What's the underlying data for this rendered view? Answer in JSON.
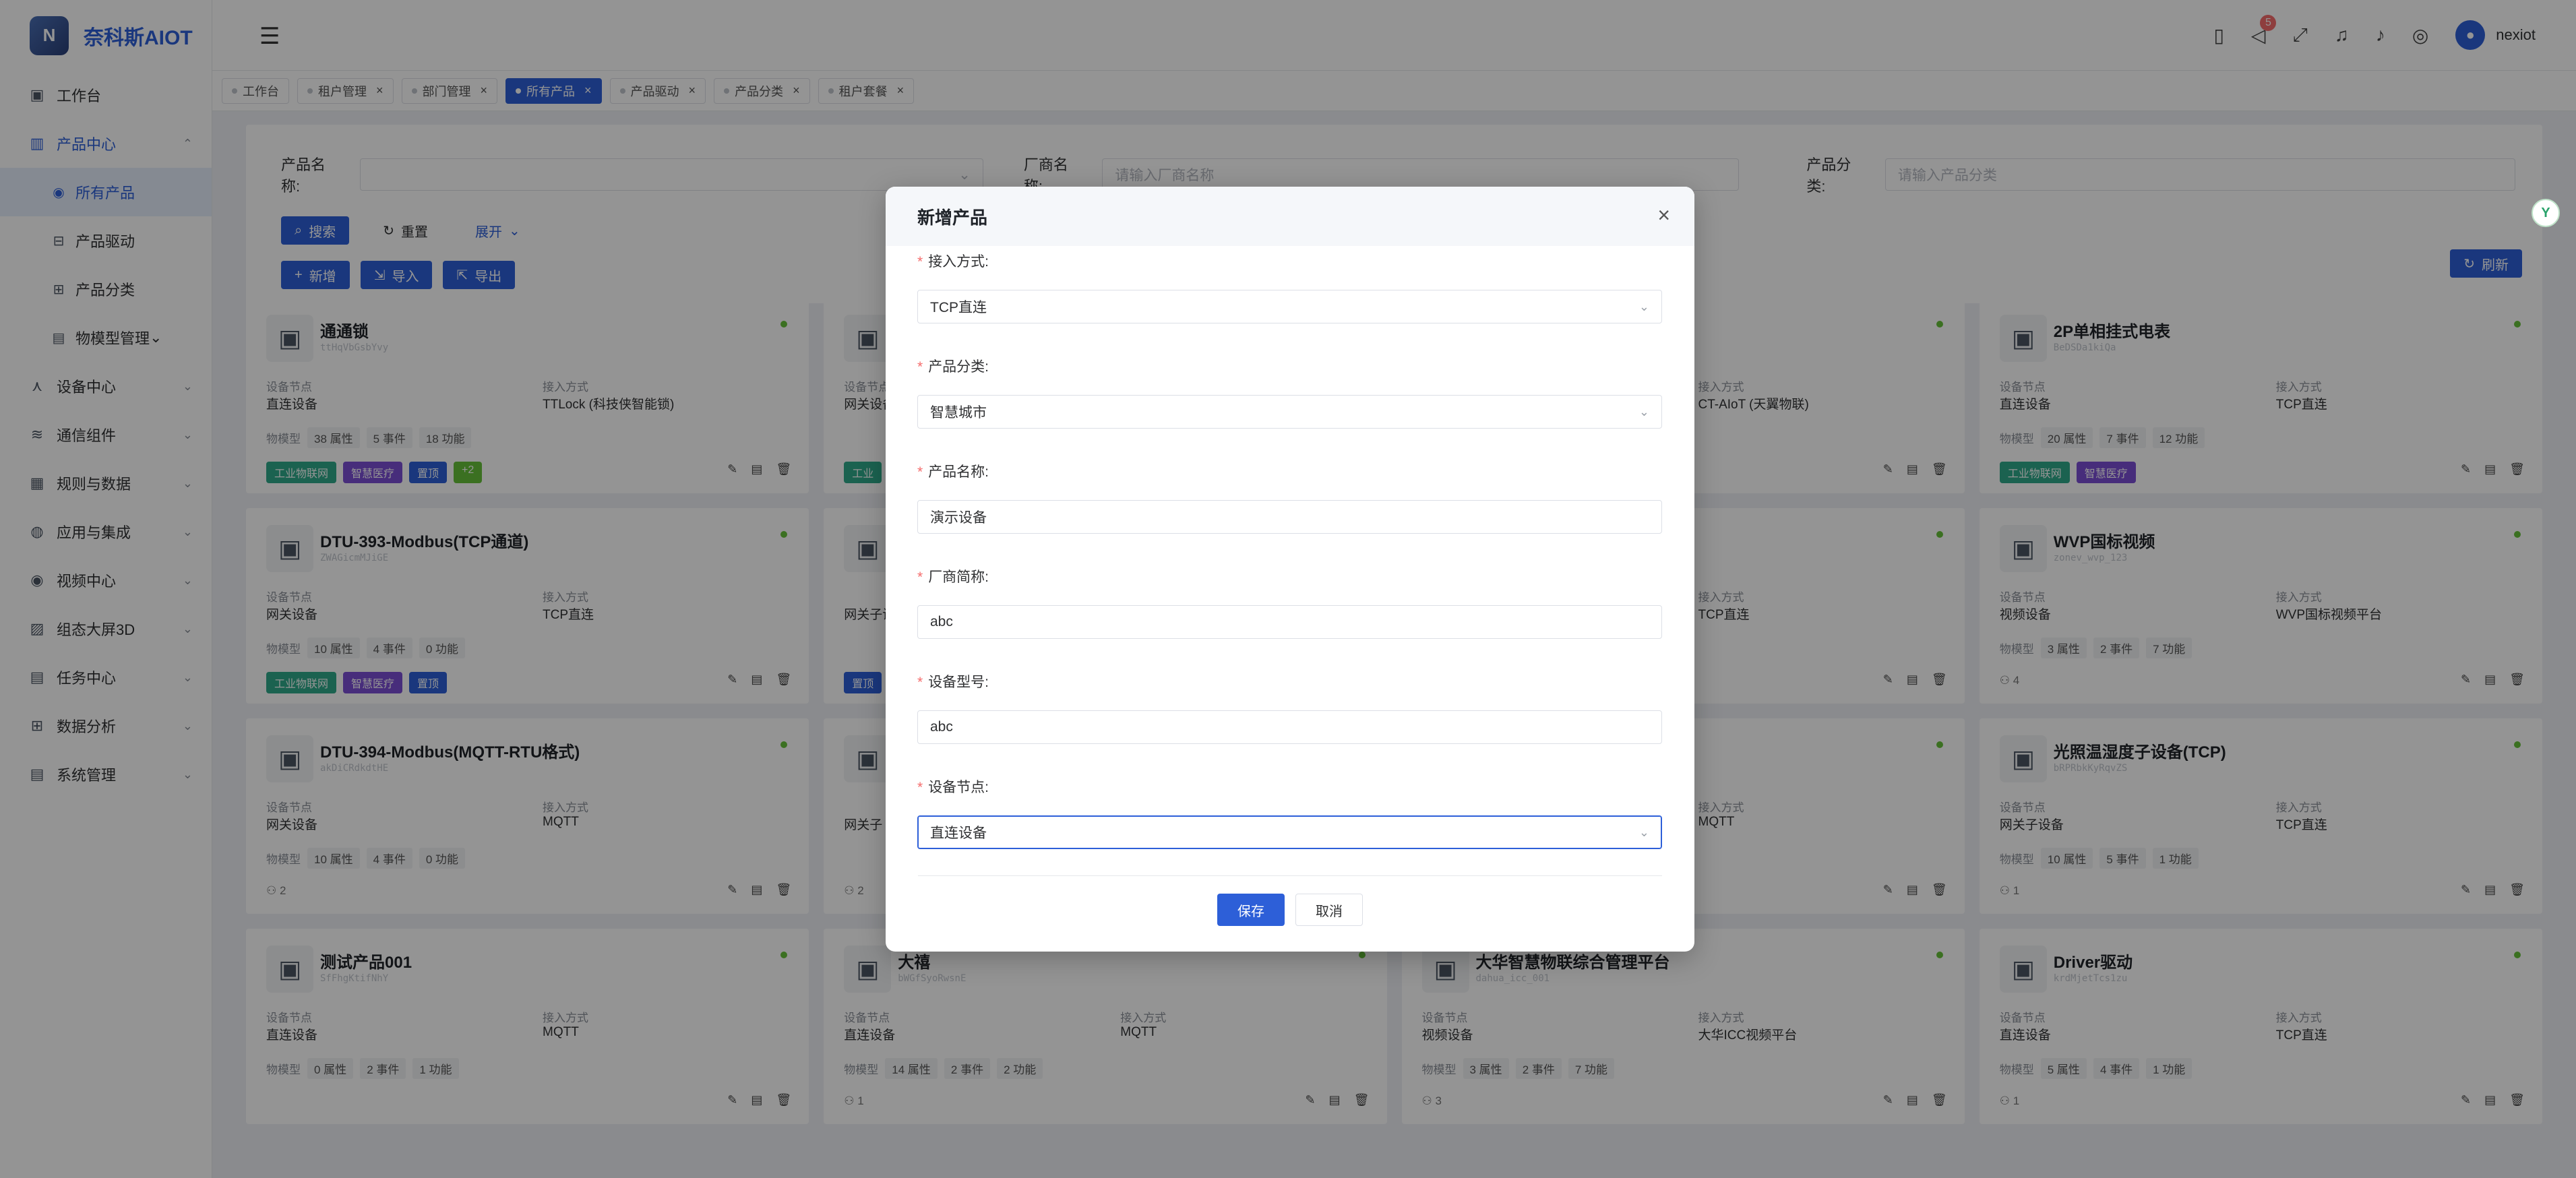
{
  "app": {
    "brand": "奈科斯AIOT",
    "user": "nexiot",
    "notification_count": "5"
  },
  "sidebar": {
    "items": [
      {
        "label": "工作台",
        "icon": "dashboard-icon"
      },
      {
        "label": "产品中心",
        "icon": "product-icon",
        "expanded": true
      },
      {
        "label": "所有产品",
        "icon": "all-products-icon",
        "sub": true,
        "active": true
      },
      {
        "label": "产品驱动",
        "icon": "driver-icon",
        "sub": true
      },
      {
        "label": "产品分类",
        "icon": "category-icon",
        "sub": true
      },
      {
        "label": "物模型管理",
        "icon": "model-icon",
        "sub": true
      },
      {
        "label": "设备中心",
        "icon": "device-icon"
      },
      {
        "label": "通信组件",
        "icon": "wifi-icon"
      },
      {
        "label": "规则与数据",
        "icon": "rule-icon"
      },
      {
        "label": "应用与集成",
        "icon": "app-icon"
      },
      {
        "label": "视频中心",
        "icon": "video-icon"
      },
      {
        "label": "组态大屏3D",
        "icon": "screen-icon"
      },
      {
        "label": "任务中心",
        "icon": "task-icon"
      },
      {
        "label": "数据分析",
        "icon": "analysis-icon"
      },
      {
        "label": "系统管理",
        "icon": "system-icon"
      }
    ]
  },
  "tabs": [
    {
      "label": "工作台",
      "closable": false
    },
    {
      "label": "租户管理",
      "closable": true
    },
    {
      "label": "部门管理",
      "closable": true
    },
    {
      "label": "所有产品",
      "closable": true,
      "active": true
    },
    {
      "label": "产品驱动",
      "closable": true
    },
    {
      "label": "产品分类",
      "closable": true
    },
    {
      "label": "租户套餐",
      "closable": true
    }
  ],
  "search": {
    "product_name_label": "产品名称:",
    "vendor_name_label": "厂商名称:",
    "vendor_name_placeholder": "请输入厂商名称",
    "category_label": "产品分类:",
    "category_placeholder": "请输入产品分类",
    "search_btn": "搜索",
    "reset_btn": "重置",
    "expand_btn": "展开"
  },
  "toolbar": {
    "add": "新增",
    "import": "导入",
    "export": "导出",
    "refresh": "刷新"
  },
  "cards": [
    {
      "title": "通通锁",
      "code": "ttHqVbGsbYvy",
      "node_label": "设备节点",
      "node": "直连设备",
      "access_label": "接入方式",
      "access": "TTLock (科技侠智能锁)",
      "model_label": "物模型",
      "attrs": "38 属性",
      "events": "5 事件",
      "funcs": "18 功能",
      "tags": [
        "工业物联网",
        "智慧医疗",
        "置顶",
        "+2"
      ],
      "count": "1"
    },
    {
      "title": "",
      "code": "",
      "node_label": "设备节点",
      "node": "网关设备",
      "access_label": "",
      "access": "",
      "model_label": "",
      "attrs": "",
      "events": "",
      "funcs": "",
      "tags": [
        "工业"
      ],
      "count": ""
    },
    {
      "title": "",
      "code": "",
      "node_label": "",
      "node": "",
      "access_label": "接入方式",
      "access": "CT-AIoT (天翼物联)",
      "model_label": "",
      "attrs": "",
      "events": "",
      "funcs": "",
      "tags": [],
      "count": ""
    },
    {
      "title": "2P单相挂式电表",
      "code": "BeDSDa1kiQa",
      "node_label": "设备节点",
      "node": "直连设备",
      "access_label": "接入方式",
      "access": "TCP直连",
      "model_label": "物模型",
      "attrs": "20 属性",
      "events": "7 事件",
      "funcs": "12 功能",
      "tags": [
        "工业物联网",
        "智慧医疗"
      ],
      "count": "3"
    },
    {
      "title": "DTU-393-Modbus(TCP通道)",
      "code": "ZWAGicmMJiGE",
      "node_label": "设备节点",
      "node": "网关设备",
      "access_label": "接入方式",
      "access": "TCP直连",
      "model_label": "物模型",
      "attrs": "10 属性",
      "events": "4 事件",
      "funcs": "0 功能",
      "tags": [
        "工业物联网",
        "智慧医疗",
        "置顶"
      ],
      "count": "2"
    },
    {
      "title": "",
      "code": "",
      "node_label": "",
      "node": "网关子设备",
      "access_label": "",
      "access": "",
      "model_label": "",
      "attrs": "",
      "events": "",
      "funcs": "",
      "tags": [
        "置顶"
      ],
      "count": ""
    },
    {
      "title": "",
      "code": "",
      "node_label": "",
      "node": "",
      "access_label": "接入方式",
      "access": "TCP直连",
      "model_label": "",
      "attrs": "",
      "events": "",
      "funcs": "",
      "tags": [],
      "count": "7"
    },
    {
      "title": "WVP国标视频",
      "code": "zonev_wvp_123",
      "node_label": "设备节点",
      "node": "视频设备",
      "access_label": "接入方式",
      "access": "WVP国标视频平台",
      "model_label": "物模型",
      "attrs": "3 属性",
      "events": "2 事件",
      "funcs": "7 功能",
      "tags": [],
      "count": "4"
    },
    {
      "title": "DTU-394-Modbus(MQTT-RTU格式)",
      "code": "akDiCRdkdtHE",
      "node_label": "设备节点",
      "node": "网关设备",
      "access_label": "接入方式",
      "access": "MQTT",
      "model_label": "物模型",
      "attrs": "10 属性",
      "events": "4 事件",
      "funcs": "0 功能",
      "tags": [],
      "count": "2"
    },
    {
      "title": "",
      "code": "",
      "node_label": "",
      "node": "网关子",
      "access_label": "",
      "access": "",
      "model_label": "",
      "attrs": "",
      "events": "",
      "funcs": "",
      "tags": [],
      "count": "2"
    },
    {
      "title": "",
      "code": "",
      "node_label": "",
      "node": "",
      "access_label": "接入方式",
      "access": "MQTT",
      "model_label": "",
      "attrs": "",
      "events": "",
      "funcs": "",
      "tags": [],
      "count": ""
    },
    {
      "title": "光照温湿度子设备(TCP)",
      "code": "bRPRbkKyRqvZS",
      "node_label": "设备节点",
      "node": "网关子设备",
      "access_label": "接入方式",
      "access": "TCP直连",
      "model_label": "物模型",
      "attrs": "10 属性",
      "events": "5 事件",
      "funcs": "1 功能",
      "tags": [],
      "count": "1"
    },
    {
      "title": "测试产品001",
      "code": "SfFhgKtifNhY",
      "node_label": "设备节点",
      "node": "直连设备",
      "access_label": "接入方式",
      "access": "MQTT",
      "model_label": "物模型",
      "attrs": "0 属性",
      "events": "2 事件",
      "funcs": "1 功能",
      "tags": [],
      "count": ""
    },
    {
      "title": "大禧",
      "code": "bWGfSyoRwsnE",
      "node_label": "设备节点",
      "node": "直连设备",
      "access_label": "接入方式",
      "access": "MQTT",
      "model_label": "物模型",
      "attrs": "14 属性",
      "events": "2 事件",
      "funcs": "2 功能",
      "tags": [],
      "count": "1"
    },
    {
      "title": "大华智慧物联综合管理平台",
      "code": "dahua_icc_001",
      "node_label": "设备节点",
      "node": "视频设备",
      "access_label": "接入方式",
      "access": "大华ICC视频平台",
      "model_label": "物模型",
      "attrs": "3 属性",
      "events": "2 事件",
      "funcs": "7 功能",
      "tags": [],
      "count": "3"
    },
    {
      "title": "Driver驱动",
      "code": "krdMjetTcs1zu",
      "node_label": "设备节点",
      "node": "直连设备",
      "access_label": "接入方式",
      "access": "TCP直连",
      "model_label": "物模型",
      "attrs": "5 属性",
      "events": "4 事件",
      "funcs": "1 功能",
      "tags": [],
      "count": "1"
    }
  ],
  "dialog": {
    "title": "新增产品",
    "fields": [
      {
        "label": "接入方式:",
        "value": "TCP直连",
        "type": "select"
      },
      {
        "label": "产品分类:",
        "value": "智慧城市",
        "type": "select"
      },
      {
        "label": "产品名称:",
        "value": "演示设备",
        "type": "input"
      },
      {
        "label": "厂商简称:",
        "value": "abc",
        "type": "input"
      },
      {
        "label": "设备型号:",
        "value": "abc",
        "type": "input"
      },
      {
        "label": "设备节点:",
        "value": "直连设备",
        "type": "select",
        "focused": true
      }
    ],
    "save": "保存",
    "cancel": "取消"
  },
  "colors": {
    "primary": "#2d5fd8",
    "mask": "rgba(0,0,0,0.42)",
    "required": "#f56c6c",
    "online": "#67c23a"
  }
}
